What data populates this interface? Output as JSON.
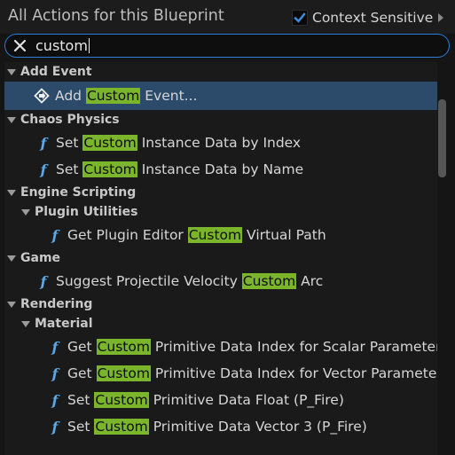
{
  "header": {
    "title": "All Actions for this Blueprint",
    "context_sensitive_label": "Context Sensitive",
    "context_sensitive_checked": true
  },
  "search": {
    "value": "custom"
  },
  "list": {
    "highlight_term": "Custom",
    "rows": [
      {
        "kind": "category",
        "depth": 0,
        "label": "Add Event"
      },
      {
        "kind": "event",
        "depth": 1,
        "pre": "Add ",
        "hl": "Custom",
        "post": " Event...",
        "icon": "event-icon",
        "selected": true
      },
      {
        "kind": "category",
        "depth": 0,
        "label": "Chaos Physics"
      },
      {
        "kind": "function",
        "depth": 1,
        "pre": "Set ",
        "hl": "Custom",
        "post": " Instance Data by Index",
        "icon": "function-icon"
      },
      {
        "kind": "function",
        "depth": 1,
        "pre": "Set ",
        "hl": "Custom",
        "post": " Instance Data by Name",
        "icon": "function-icon"
      },
      {
        "kind": "category",
        "depth": 0,
        "label": "Engine Scripting"
      },
      {
        "kind": "category",
        "depth": 1,
        "label": "Plugin Utilities"
      },
      {
        "kind": "function",
        "depth": 2,
        "pre": "Get Plugin Editor ",
        "hl": "Custom",
        "post": " Virtual Path",
        "icon": "function-icon"
      },
      {
        "kind": "category",
        "depth": 0,
        "label": "Game"
      },
      {
        "kind": "function",
        "depth": 1,
        "pre": "Suggest Projectile Velocity ",
        "hl": "Custom",
        "post": " Arc",
        "icon": "function-icon"
      },
      {
        "kind": "category",
        "depth": 0,
        "label": "Rendering"
      },
      {
        "kind": "category",
        "depth": 1,
        "label": "Material"
      },
      {
        "kind": "function",
        "depth": 2,
        "pre": "Get ",
        "hl": "Custom",
        "post": " Primitive Data Index for Scalar Parameter",
        "icon": "function-icon"
      },
      {
        "kind": "function",
        "depth": 2,
        "pre": "Get ",
        "hl": "Custom",
        "post": " Primitive Data Index for Vector Parameter",
        "icon": "function-icon"
      },
      {
        "kind": "function",
        "depth": 2,
        "pre": "Set ",
        "hl": "Custom",
        "post": " Primitive Data Float (P_Fire)",
        "icon": "function-icon"
      },
      {
        "kind": "function",
        "depth": 2,
        "pre": "Set ",
        "hl": "Custom",
        "post": " Primitive Data Vector 3 (P_Fire)",
        "icon": "function-icon"
      }
    ]
  },
  "colors": {
    "accent": "#2f7fd6",
    "highlight": "#7ab52c",
    "selection": "#2c4a6a",
    "function_icon": "#5aa8e8"
  }
}
